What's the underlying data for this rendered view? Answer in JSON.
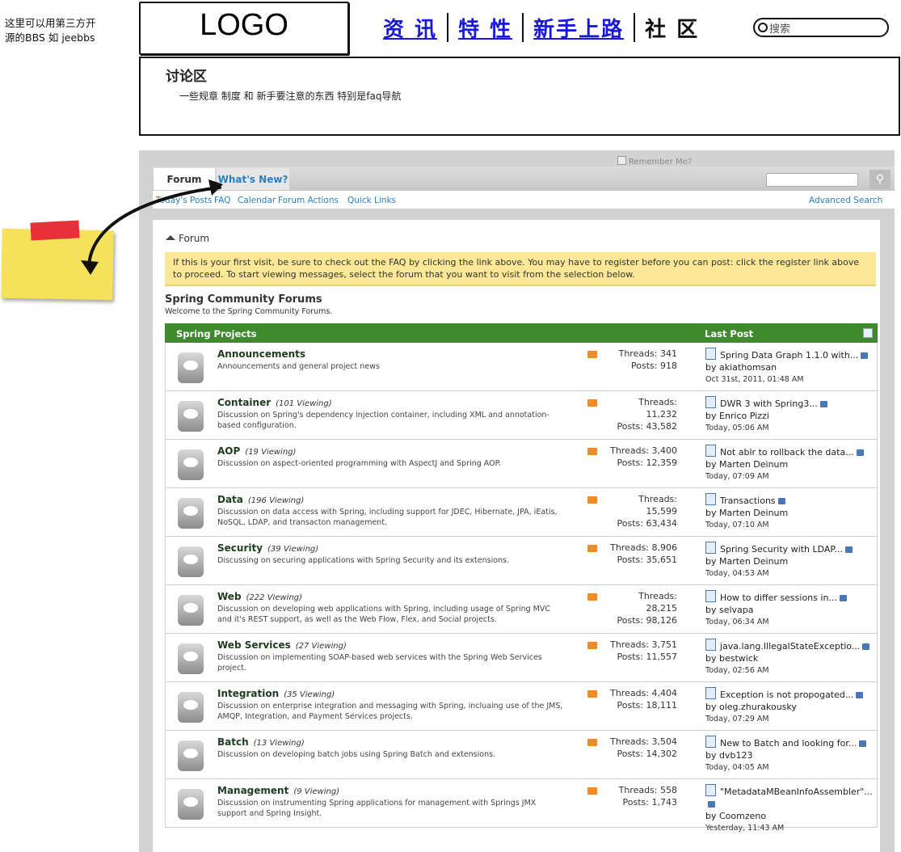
{
  "wireframe": {
    "logo": "LOGO",
    "nav": [
      "资 讯",
      "特 性",
      "新手上路",
      "社 区"
    ],
    "search_placeholder": "搜索",
    "discussion_title": "讨论区",
    "discussion_desc": "一些规章 制度  和 新手要注意的东西 特别是faq导航"
  },
  "sticky_note": {
    "text": "这里可以用第三方开源的BBS  如 jeebbs"
  },
  "forum": {
    "remember_me": "Remember Me?",
    "tabs": [
      "Forum",
      "What's New?"
    ],
    "subnav": [
      "Today's Posts",
      "FAQ",
      "Calendar",
      "Forum Actions",
      "Quick Links"
    ],
    "advanced_search": "Advanced Search",
    "breadcrumb": "Forum",
    "notice": "If this is your first visit, be sure to check out the FAQ by clicking the link above. You may have to register before you can post: click the register link above to proceed. To start viewing messages, select the forum that you want to visit from the selection below.",
    "title": "Spring Community Forums",
    "subtitle": "Welcome to the Spring Community Forums.",
    "section": "Spring Projects",
    "last_post_header": "Last Post",
    "rows": [
      {
        "name": "Announcements",
        "viewing": "",
        "desc": "Announcements and general project news",
        "threads": "Threads: 341",
        "posts": "Posts: 918",
        "lp_title": "Spring Data Graph 1.1.0 with...",
        "lp_by": "by akiathomsan",
        "lp_date": "Oct 31st, 2011, 01:48 AM"
      },
      {
        "name": "Container",
        "viewing": "(101 Viewing)",
        "desc": "Discussion on Spring's dependency injection container, including XML and annotation-based configuration.",
        "threads": "Threads: 11,232",
        "posts": "Posts: 43,582",
        "lp_title": "DWR 3 with Spring3...",
        "lp_by": "by Enrico Pizzi",
        "lp_date": "Today, 05:06 AM"
      },
      {
        "name": "AOP",
        "viewing": "(19 Viewing)",
        "desc": "Discussion on aspect-oriented programming with AspectJ and Spring AOP.",
        "threads": "Threads: 3,400",
        "posts": "Posts: 12,359",
        "lp_title": "Not ablr to rollback the data...",
        "lp_by": "by Marten Deinum",
        "lp_date": "Today, 07:09 AM"
      },
      {
        "name": "Data",
        "viewing": "(196 Viewing)",
        "desc": "Discussion on data access with Spring, including support for JDEC, Hibernate, JPA, iEatis, NoSQL, LDAP, and transacton management.",
        "threads": "Threads: 15,599",
        "posts": "Posts: 63,434",
        "lp_title": "Transactions",
        "lp_by": "by Marten Deinum",
        "lp_date": "Today, 07:10 AM"
      },
      {
        "name": "Security",
        "viewing": "(39 Viewing)",
        "desc": "Discussing on securing applications with Spring Security and its extensions.",
        "threads": "Threads: 8,906",
        "posts": "Posts: 35,651",
        "lp_title": "Spring Security with LDAP...",
        "lp_by": "by Marten Deinum",
        "lp_date": "Today, 04:53 AM"
      },
      {
        "name": "Web",
        "viewing": "(222 Viewing)",
        "desc": "Discussion on developing web applications with Spring, including usage of Spring MVC and it's REST support, as well as the Web Flow, Flex, and Social projects.",
        "threads": "Threads: 28,215",
        "posts": "Posts: 98,126",
        "lp_title": "How to differ sessions in...",
        "lp_by": "by selvapa",
        "lp_date": "Today, 06:34 AM"
      },
      {
        "name": "Web Services",
        "viewing": "(27 Viewing)",
        "desc": "Discussion on implementing SOAP-based web services with the Spring Web Services project.",
        "threads": "Threads: 3,751",
        "posts": "Posts: 11,557",
        "lp_title": "java.lang.IllegalStateExceptio...",
        "lp_by": "by bestwick",
        "lp_date": "Today, 02:56 AM"
      },
      {
        "name": "Integration",
        "viewing": "(35 Viewing)",
        "desc": "Discussion on enterprise integration and messaging with Spring, incluaing use of the JMS, AMQP, Integration, and Payment Services projects.",
        "threads": "Threads: 4,404",
        "posts": "Posts: 18,111",
        "lp_title": "Exception is not propogated...",
        "lp_by": "by oleg.zhurakousky",
        "lp_date": "Today, 07:29 AM"
      },
      {
        "name": "Batch",
        "viewing": "(13 Viewing)",
        "desc": "Discussion on developing batch jobs using Spring Batch and extensions.",
        "threads": "Threads: 3,504",
        "posts": "Posts: 14,302",
        "lp_title": "New to Batch and looking for...",
        "lp_by": "by dvb123",
        "lp_date": "Today, 04:05 AM"
      },
      {
        "name": "Management",
        "viewing": "(9 Viewing)",
        "desc": "Discussion on instrumenting Spring applications for management with Springs JMX support and Spring Insight.",
        "threads": "Threads: 558",
        "posts": "Posts: 1,743",
        "lp_title": "\"MetadataMBeanInfoAssembler\"...",
        "lp_by": "by Coomzeno",
        "lp_date": "Yesterday, 11:43 AM"
      }
    ]
  }
}
